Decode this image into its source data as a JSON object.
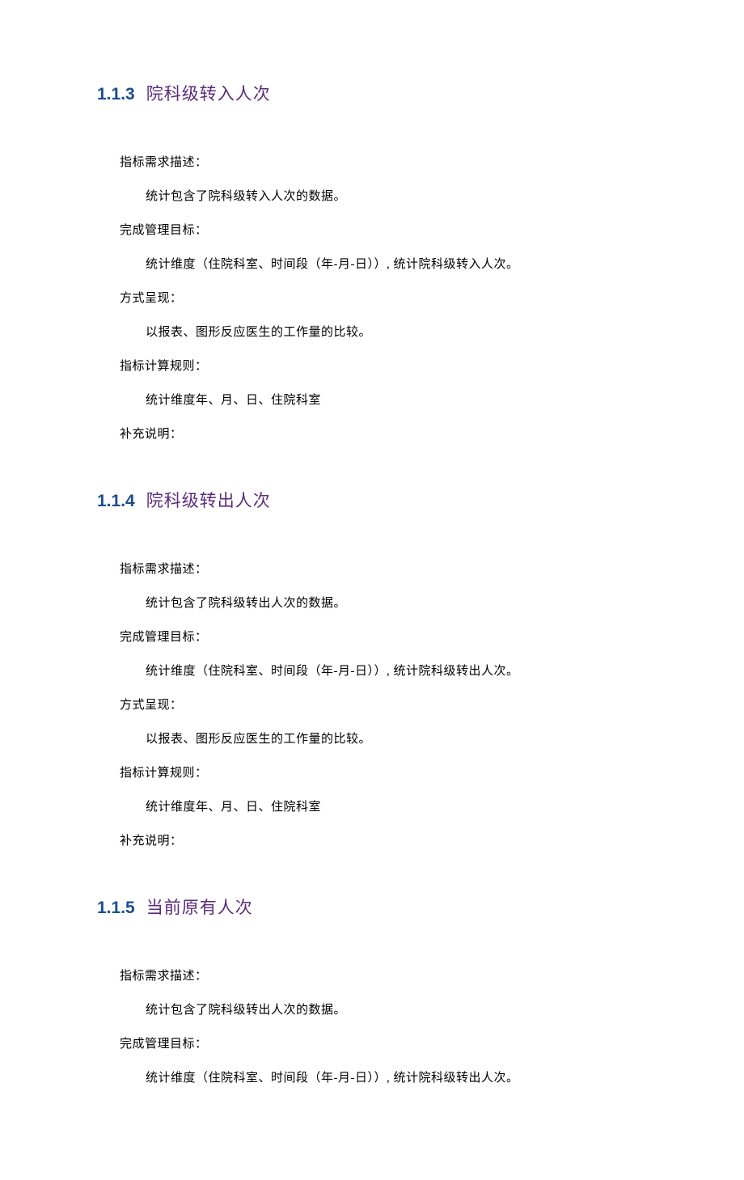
{
  "sections": [
    {
      "number": "1.1.3",
      "title": "院科级转入人次",
      "items": [
        {
          "label": "指标需求描述：",
          "content": "统计包含了院科级转入人次的数据。"
        },
        {
          "label": "完成管理目标：",
          "content": "统计维度（住院科室、时间段（年-月-日））, 统计院科级转入人次。"
        },
        {
          "label": "方式呈现：",
          "content": "以报表、图形反应医生的工作量的比较。"
        },
        {
          "label": "指标计算规则：",
          "content": "统计维度年、月、日、住院科室"
        },
        {
          "label": "补充说明：",
          "content": ""
        }
      ]
    },
    {
      "number": "1.1.4",
      "title": "院科级转出人次",
      "items": [
        {
          "label": "指标需求描述：",
          "content": "统计包含了院科级转出人次的数据。"
        },
        {
          "label": "完成管理目标：",
          "content": "统计维度（住院科室、时间段（年-月-日））, 统计院科级转出人次。"
        },
        {
          "label": "方式呈现：",
          "content": "以报表、图形反应医生的工作量的比较。"
        },
        {
          "label": "指标计算规则：",
          "content": "统计维度年、月、日、住院科室"
        },
        {
          "label": "补充说明：",
          "content": ""
        }
      ]
    },
    {
      "number": "1.1.5",
      "title": "当前原有人次",
      "items": [
        {
          "label": "指标需求描述：",
          "content": "统计包含了院科级转出人次的数据。"
        },
        {
          "label": "完成管理目标：",
          "content": "统计维度（住院科室、时间段（年-月-日））, 统计院科级转出人次。"
        }
      ]
    }
  ]
}
